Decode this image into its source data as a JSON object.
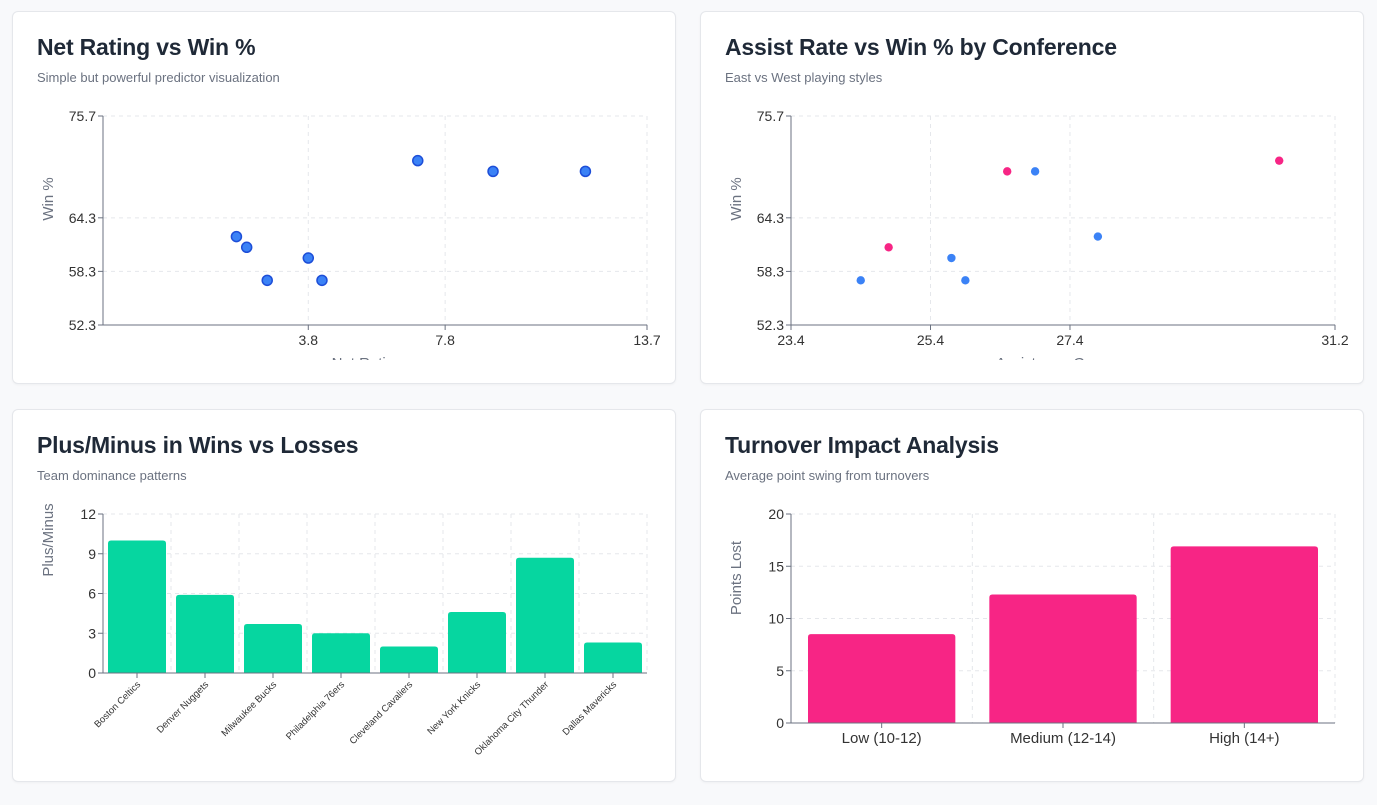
{
  "colors": {
    "blue": "#3b82f6",
    "blue_stroke": "#1d4ed8",
    "pink": "#f72585",
    "green": "#06d6a0",
    "grid": "#e5e7eb",
    "axis": "#6b7280"
  },
  "cards": [
    {
      "title": "Net Rating vs Win %",
      "subtitle": "Simple but powerful predictor visualization"
    },
    {
      "title": "Assist Rate vs Win % by Conference",
      "subtitle": "East vs West playing styles"
    },
    {
      "title": "Plus/Minus in Wins vs Losses",
      "subtitle": "Team dominance patterns"
    },
    {
      "title": "Turnover Impact Analysis",
      "subtitle": "Average point swing from turnovers"
    }
  ],
  "chart_data": [
    {
      "type": "scatter",
      "title": "Net Rating vs Win %",
      "xlabel": "Net Rating",
      "ylabel": "Win %",
      "xlim": [
        -2.2,
        13.7
      ],
      "ylim": [
        52.3,
        75.7
      ],
      "xticks": [
        "3.8",
        "7.8",
        "13.7"
      ],
      "yticks": [
        "75.7",
        "64.3",
        "58.3",
        "52.3"
      ],
      "grid": true,
      "points": [
        {
          "x": 1.7,
          "y": 62.2
        },
        {
          "x": 2.0,
          "y": 61.0
        },
        {
          "x": 2.6,
          "y": 57.3
        },
        {
          "x": 3.8,
          "y": 59.8
        },
        {
          "x": 4.2,
          "y": 57.3
        },
        {
          "x": 7.0,
          "y": 70.7
        },
        {
          "x": 9.2,
          "y": 69.5
        },
        {
          "x": 11.9,
          "y": 69.5
        }
      ]
    },
    {
      "type": "scatter",
      "title": "Assist Rate vs Win % by Conference",
      "xlabel": "Assists per Game",
      "ylabel": "Win %",
      "xlim": [
        23.4,
        31.2
      ],
      "ylim": [
        52.3,
        75.7
      ],
      "xticks": [
        "23.4",
        "25.4",
        "27.4",
        "31.2"
      ],
      "yticks": [
        "75.7",
        "64.3",
        "58.3",
        "52.3"
      ],
      "grid": true,
      "series": [
        {
          "color": "#f72585",
          "points": [
            {
              "x": 24.8,
              "y": 61.0
            },
            {
              "x": 26.5,
              "y": 69.5
            },
            {
              "x": 30.4,
              "y": 70.7
            }
          ]
        },
        {
          "color": "#3b82f6",
          "points": [
            {
              "x": 24.4,
              "y": 57.3
            },
            {
              "x": 25.7,
              "y": 59.8
            },
            {
              "x": 25.9,
              "y": 57.3
            },
            {
              "x": 26.9,
              "y": 69.5
            },
            {
              "x": 27.8,
              "y": 62.2
            }
          ]
        }
      ]
    },
    {
      "type": "bar",
      "title": "Plus/Minus in Wins vs Losses",
      "ylabel": "Plus/Minus",
      "ylim": [
        0,
        12
      ],
      "yticks": [
        "12",
        "9",
        "6",
        "3",
        "0"
      ],
      "grid": true,
      "categories": [
        "Boston Celtics",
        "Denver Nuggets",
        "Milwaukee Bucks",
        "Philadelphia 76ers",
        "Cleveland Cavaliers",
        "New York Knicks",
        "Oklahoma City Thunder",
        "Dallas Mavericks"
      ],
      "values": [
        10.0,
        5.9,
        3.7,
        3.0,
        2.0,
        4.6,
        8.7,
        2.3
      ],
      "color": "#06d6a0"
    },
    {
      "type": "bar",
      "title": "Turnover Impact Analysis",
      "ylabel": "Points Lost",
      "ylim": [
        0,
        20
      ],
      "yticks": [
        "20",
        "15",
        "10",
        "5",
        "0"
      ],
      "grid": true,
      "categories": [
        "Low (10-12)",
        "Medium (12-14)",
        "High (14+)"
      ],
      "values": [
        8.5,
        12.3,
        16.9
      ],
      "color": "#f72585"
    }
  ]
}
